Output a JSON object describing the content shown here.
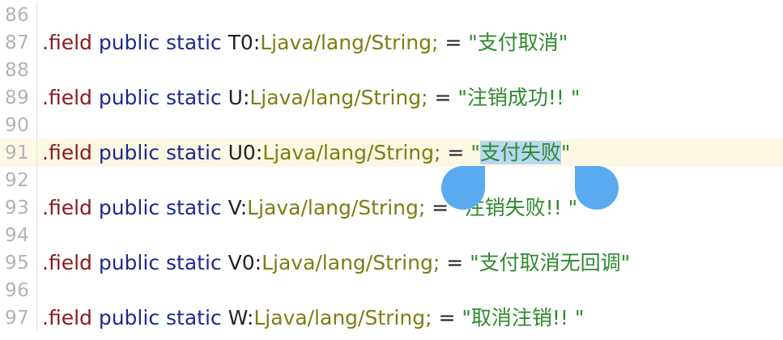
{
  "lines": [
    {
      "num": "86"
    },
    {
      "num": "87",
      "directive": ".field",
      "modifiers": [
        "public",
        "static"
      ],
      "name": "T0",
      "type": "Ljava/lang/String;",
      "eq": "=",
      "open_quote": "\"",
      "value": "支付取消",
      "close_quote": "\""
    },
    {
      "num": "88"
    },
    {
      "num": "89",
      "directive": ".field",
      "modifiers": [
        "public",
        "static"
      ],
      "name": "U",
      "type": "Ljava/lang/String;",
      "eq": "=",
      "open_quote": "\"",
      "value": "注销成功!! ",
      "close_quote": "\""
    },
    {
      "num": "90"
    },
    {
      "num": "91",
      "directive": ".field",
      "modifiers": [
        "public",
        "static"
      ],
      "name": "U0",
      "type": "Ljava/lang/String;",
      "eq": "=",
      "open_quote": "\"",
      "value": "支付失败",
      "close_quote": "\""
    },
    {
      "num": "92"
    },
    {
      "num": "93",
      "directive": ".field",
      "modifiers": [
        "public",
        "static"
      ],
      "name": "V",
      "type": "Ljava/lang/String;",
      "eq": "=",
      "open_quote": "\"",
      "value": "注销失败!! ",
      "close_quote": "\""
    },
    {
      "num": "94"
    },
    {
      "num": "95",
      "directive": ".field",
      "modifiers": [
        "public",
        "static"
      ],
      "name": "V0",
      "type": "Ljava/lang/String;",
      "eq": "=",
      "open_quote": "\"",
      "value": "支付取消无回调",
      "close_quote": "\""
    },
    {
      "num": "96"
    },
    {
      "num": "97",
      "directive": ".field",
      "modifiers": [
        "public",
        "static"
      ],
      "name": "W",
      "type": "Ljava/lang/String;",
      "eq": "=",
      "open_quote": "\"",
      "value": "取消注销!! ",
      "close_quote": "\""
    }
  ],
  "colors": {
    "directive": "#8b1a1a",
    "keyword": "#1c2a8c",
    "type": "#7d7d12",
    "string": "#2f8a2f",
    "line_number": "#b3b3b3",
    "current_line_bg": "#fdf8e4",
    "selection_bg": "#b9d7f2",
    "selection_handle": "#5aaaf0"
  },
  "icons": {
    "selection_handles": [
      "selection-handle-start-icon",
      "selection-handle-end-icon"
    ]
  }
}
